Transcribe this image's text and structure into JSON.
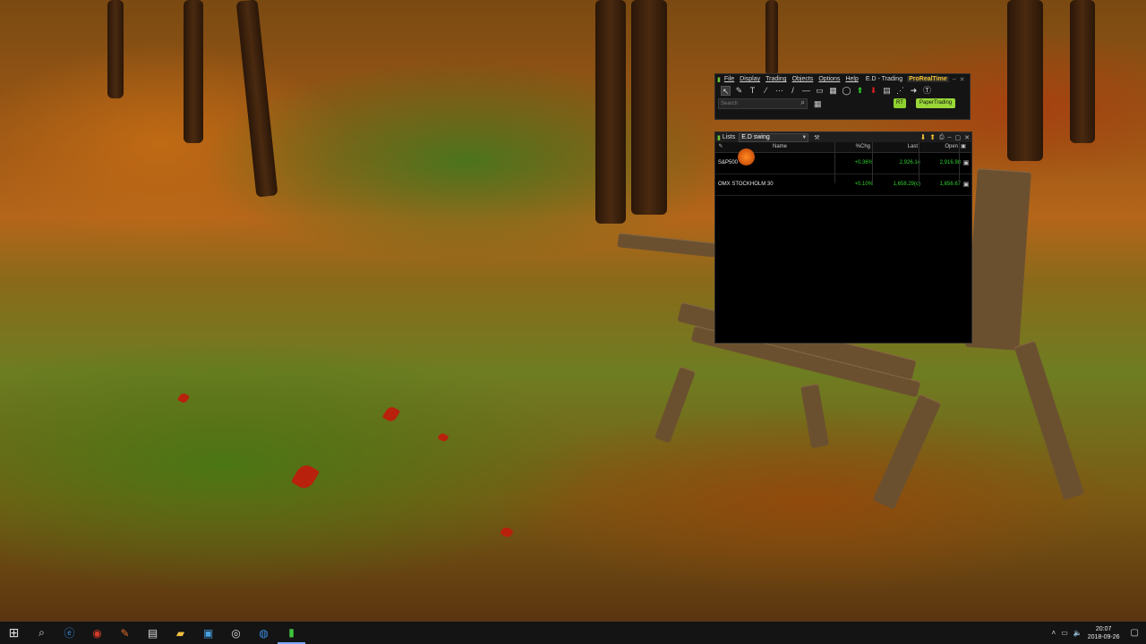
{
  "prorealtime": {
    "menu": [
      "File",
      "Display",
      "Trading",
      "Objects",
      "Options",
      "Help"
    ],
    "workspace": "E.D - Trading",
    "brand": "ProRealTime",
    "search_placeholder": "Search",
    "rt_label": "RT",
    "paper_trading_label": "PaperTrading"
  },
  "lists_window": {
    "title": "Lists",
    "selected_list": "E.D swing",
    "columns": [
      "Name",
      "%Chg",
      "Last",
      "Open"
    ],
    "rows": [
      {
        "name": "S&P500",
        "pct_chg": "+0.36%",
        "last": "2,926.14",
        "open": "2,916.98"
      },
      {
        "name": "OMX STOCKHOLM 30",
        "pct_chg": "+0.10%",
        "last": "1,658.29(c)",
        "open": "1,656.67"
      }
    ]
  },
  "taskbar": {
    "apps": [
      "start-icon",
      "search-icon",
      "edge-icon",
      "antivirus-icon",
      "paint-icon",
      "explorer-icon",
      "files-icon",
      "settings-icon",
      "network-icon",
      "browser-icon",
      "prorealtime-icon"
    ],
    "time": "20:07",
    "date": "2018-09-26"
  }
}
